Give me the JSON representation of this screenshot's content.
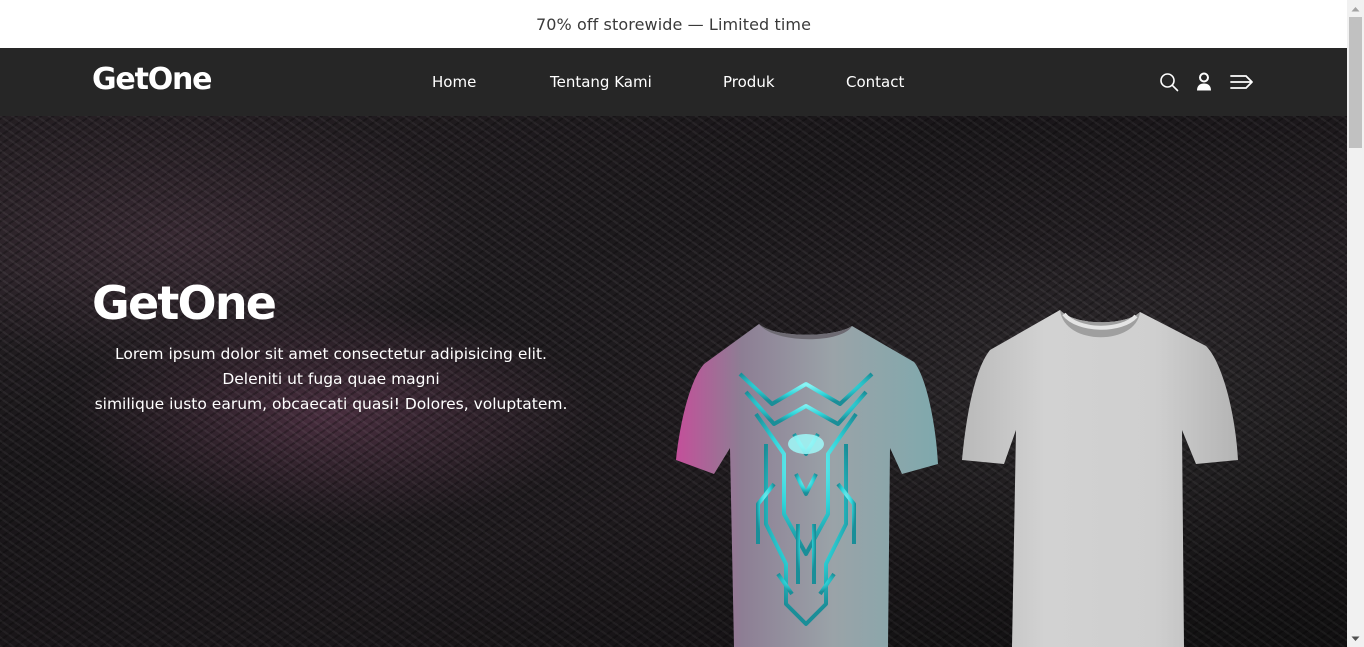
{
  "promo": {
    "text": "70% off storewide — Limited time"
  },
  "header": {
    "logo": "GetOne",
    "nav": [
      {
        "label": "Home"
      },
      {
        "label": "Tentang Kami"
      },
      {
        "label": "Produk"
      },
      {
        "label": "Contact"
      }
    ],
    "icons": [
      "search-icon",
      "user-icon",
      "menu-icon"
    ]
  },
  "hero": {
    "title": "GetOne",
    "lines": [
      "Lorem ipsum dolor sit amet consectetur adipisicing elit.",
      "Deleniti ut fuga quae magni",
      "similique iusto earum, obcaecati quasi! Dolores, voluptatem."
    ]
  },
  "colors": {
    "navbar": "#262626",
    "accent_cyan": "#3fe6e6",
    "accent_magenta": "#c050a0"
  }
}
